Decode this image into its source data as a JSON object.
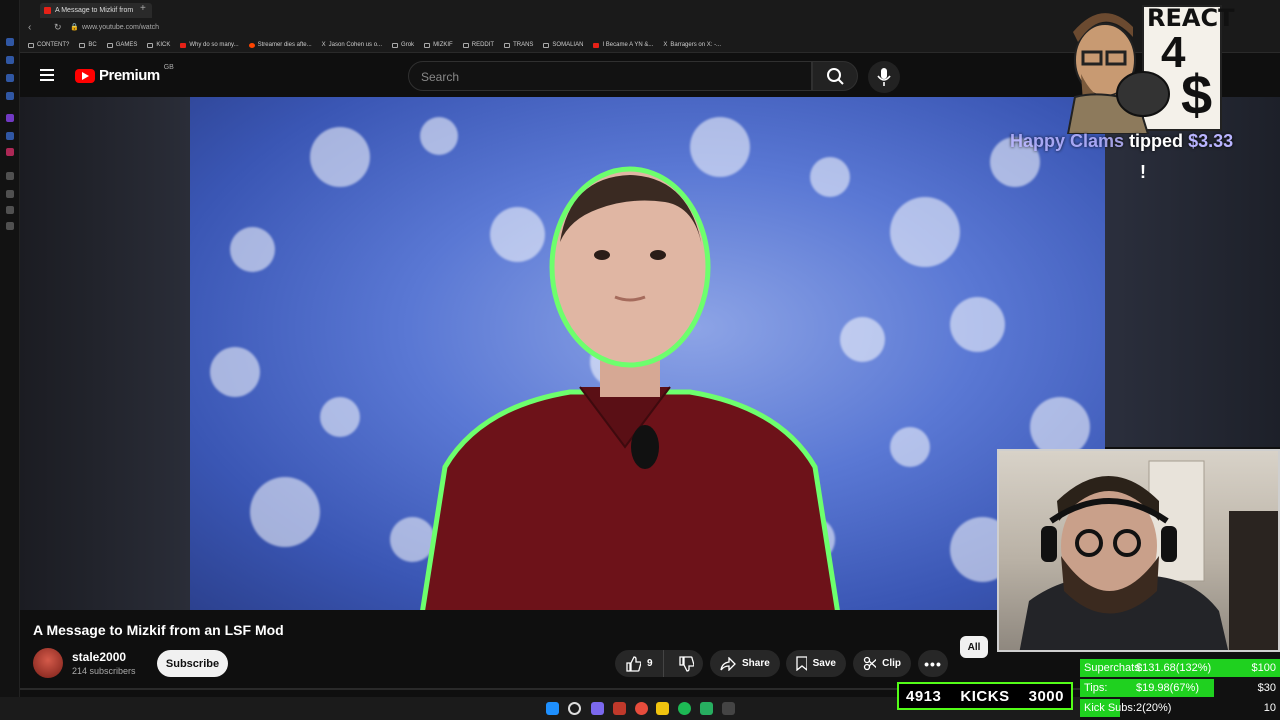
{
  "browser": {
    "tab_title": "A Message to Mizkif from",
    "url": "www.youtube.com/watch",
    "bookmarks": [
      "CONTENT?",
      "BC",
      "GAMES",
      "KICK",
      "Why do so many...",
      "Streamer dies afte...",
      "Jason Cohen us o...",
      "Grok",
      "MIZKIF",
      "REDDIT",
      "TRANS",
      "SOMALIAN",
      "I Became A YN &...",
      "Barragers on X: -..."
    ]
  },
  "header": {
    "logo_text": "Premium",
    "region": "GB",
    "search_placeholder": "Search"
  },
  "video": {
    "title": "A Message to Mizkif from an LSF Mod",
    "channel_name": "stale2000",
    "channel_subs": "214 subscribers",
    "subscribe_label": "Subscribe",
    "like_count": "9",
    "share_label": "Share",
    "save_label": "Save",
    "clip_label": "Clip",
    "filter_chip": "All"
  },
  "overlay": {
    "react_line1": "REACT",
    "react_line2": "4",
    "react_line3": "$",
    "tip_user": "Happy Clams",
    "tip_verb": "tipped",
    "tip_amount": "$3.33",
    "tip_excl": "!",
    "kick_count": "4913",
    "kick_label": "KICKS",
    "kick_goal": "3000",
    "goals": [
      {
        "label": "Superchats:",
        "value": "$131.68(132%)",
        "max": "$100",
        "fill": 1.0
      },
      {
        "label": "Tips:",
        "value": "$19.98(67%)",
        "max": "$30",
        "fill": 0.67
      },
      {
        "label": "Kick Subs:",
        "value": "2(20%)",
        "max": "10",
        "fill": 0.2
      }
    ]
  },
  "colors": {
    "youtube_red": "#ff0000",
    "kick_green": "#53fc18",
    "goal_green": "#1fd11f",
    "tip_purple": "#b9b4ff"
  }
}
